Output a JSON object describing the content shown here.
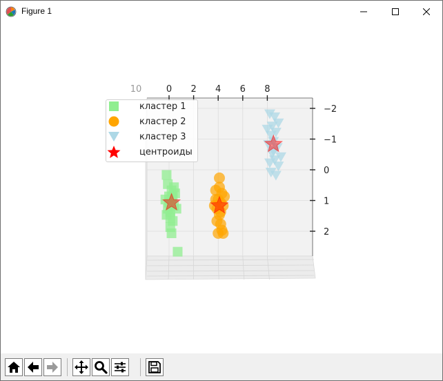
{
  "window": {
    "title": "Figure 1"
  },
  "colors": {
    "cluster1": "#90ee90",
    "cluster2": "#ffa500",
    "cluster3": "#add8e6",
    "centroid": "#ff0000"
  },
  "legend": [
    {
      "label": "кластер 1",
      "marker": "square",
      "color": "#90ee90"
    },
    {
      "label": "кластер 2",
      "marker": "circle",
      "color": "#ffa500"
    },
    {
      "label": "кластер 3",
      "marker": "triangle-down",
      "color": "#add8e6"
    },
    {
      "label": "центроиды",
      "marker": "star",
      "color": "#ff0000"
    }
  ],
  "axes": {
    "top_ticks": [
      "10",
      "0",
      "2",
      "4",
      "6",
      "8"
    ],
    "right_ticks": [
      "−2",
      "−1",
      "0",
      "1",
      "2"
    ]
  },
  "chart_data": {
    "type": "scatter",
    "projection": "3d",
    "series": [
      {
        "name": "кластер 1",
        "marker": "square",
        "color": "#90ee90",
        "points": [
          [
            -0.2,
            0.1
          ],
          [
            0.3,
            0.8
          ],
          [
            0.1,
            1.5
          ],
          [
            -0.1,
            1.2
          ],
          [
            0.2,
            0.9
          ],
          [
            0.0,
            1.0
          ],
          [
            0.4,
            1.1
          ],
          [
            -0.3,
            0.9
          ],
          [
            0.2,
            0.6
          ],
          [
            0.5,
            0.7
          ],
          [
            0.1,
            1.3
          ],
          [
            -0.2,
            1.4
          ],
          [
            0.3,
            1.6
          ],
          [
            0.6,
            1.2
          ],
          [
            0.0,
            0.8
          ],
          [
            0.2,
            2.0
          ],
          [
            0.7,
            2.6
          ],
          [
            -0.1,
            0.4
          ],
          [
            0.4,
            0.5
          ],
          [
            0.1,
            1.8
          ]
        ]
      },
      {
        "name": "кластер 2",
        "marker": "circle",
        "color": "#ffa500",
        "points": [
          [
            3.8,
            0.6
          ],
          [
            4.1,
            0.5
          ],
          [
            4.3,
            0.7
          ],
          [
            4.0,
            0.9
          ],
          [
            4.2,
            1.0
          ],
          [
            3.9,
            1.2
          ],
          [
            4.4,
            1.1
          ],
          [
            4.1,
            1.4
          ],
          [
            3.9,
            1.6
          ],
          [
            4.2,
            1.7
          ],
          [
            4.3,
            1.9
          ],
          [
            4.0,
            2.0
          ],
          [
            4.4,
            2.0
          ],
          [
            3.8,
            0.9
          ],
          [
            4.5,
            0.8
          ],
          [
            4.1,
            0.2
          ],
          [
            3.7,
            1.1
          ],
          [
            4.2,
            1.3
          ]
        ]
      },
      {
        "name": "кластер 3",
        "marker": "triangle-down",
        "color": "#add8e6",
        "points": [
          [
            8.2,
            -1.9
          ],
          [
            8.6,
            -1.8
          ],
          [
            8.4,
            -1.5
          ],
          [
            8.9,
            -1.6
          ],
          [
            8.3,
            -1.2
          ],
          [
            8.7,
            -1.3
          ],
          [
            8.5,
            -1.0
          ],
          [
            8.1,
            -0.9
          ],
          [
            8.8,
            -0.8
          ],
          [
            8.4,
            -0.6
          ],
          [
            8.6,
            -0.4
          ],
          [
            8.2,
            -0.3
          ],
          [
            8.9,
            -0.2
          ],
          [
            9.1,
            -0.5
          ],
          [
            8.3,
            0.0
          ],
          [
            8.7,
            0.1
          ],
          [
            8.5,
            -0.7
          ],
          [
            8.0,
            -1.4
          ]
        ]
      },
      {
        "name": "центроиды",
        "marker": "star",
        "color": "#ff0000",
        "points": [
          [
            0.2,
            1.0
          ],
          [
            4.1,
            1.1
          ],
          [
            8.5,
            -0.9
          ]
        ]
      }
    ],
    "xlim": [
      -2,
      10
    ],
    "ylim": [
      2.9,
      -2.6
    ],
    "grid": true,
    "legend_position": "top-left"
  },
  "toolbar": {
    "buttons": [
      {
        "name": "home-button",
        "icon": "home-icon"
      },
      {
        "name": "back-button",
        "icon": "arrow-left-icon"
      },
      {
        "name": "forward-button",
        "icon": "arrow-right-icon"
      },
      {
        "name": "pan-button",
        "icon": "move-icon"
      },
      {
        "name": "zoom-button",
        "icon": "magnifier-icon"
      },
      {
        "name": "subplots-button",
        "icon": "sliders-icon"
      },
      {
        "name": "save-button",
        "icon": "floppy-icon"
      }
    ]
  }
}
